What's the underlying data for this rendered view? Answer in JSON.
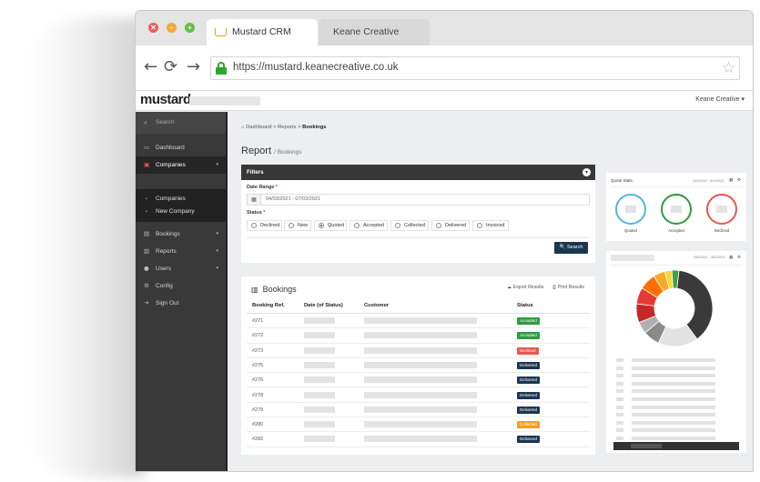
{
  "browser": {
    "tabs": [
      {
        "label": "Mustard CRM"
      },
      {
        "label": "Keane Creative"
      }
    ],
    "url": "https://mustard.keanecreative.co.uk",
    "nav_icons": {
      "back": "←",
      "reload": "⟳",
      "forward": "→",
      "star": "☆"
    },
    "window_buttons": {
      "close": "✕",
      "minimize": "–",
      "maximize": "+"
    }
  },
  "app": {
    "logo": "mustard",
    "user_menu": "Keane Creative ▾"
  },
  "sidebar": {
    "search_placeholder": "Search",
    "items": [
      {
        "label": "Dashboard",
        "icon": "monitor-icon",
        "glyph": "▭"
      },
      {
        "label": "Companies",
        "icon": "id-card-icon",
        "glyph": "▣",
        "caret": "▾"
      },
      {
        "label": "Bookings",
        "icon": "book-icon",
        "glyph": "▤",
        "caret": "▾"
      },
      {
        "label": "Reports",
        "icon": "bar-chart-icon",
        "glyph": "▥",
        "caret": "▾"
      },
      {
        "label": "Users",
        "icon": "users-icon",
        "glyph": "●",
        "caret": "▾"
      },
      {
        "label": "Config",
        "icon": "cogs-icon",
        "glyph": "⚙"
      },
      {
        "label": "Sign Out",
        "icon": "sign-out-icon",
        "glyph": "⇥"
      }
    ],
    "subitems": [
      {
        "label": "Companies"
      },
      {
        "label": "New Company"
      }
    ]
  },
  "breadcrumb": {
    "home": "⌂ Dashboard",
    "sep1": ">",
    "reports": "Reports",
    "sep2": ">",
    "current": "Bookings"
  },
  "page": {
    "title": "Report",
    "subtitle": "/ Bookings"
  },
  "filters": {
    "header": "Filters",
    "toggle": "▾",
    "date_label": "Date Range",
    "date_value": "04/03/2021 - 07/03/2021",
    "status_label": "Status",
    "required_mark": "*",
    "statuses": [
      {
        "label": "Declined",
        "selected": false
      },
      {
        "label": "New",
        "selected": false
      },
      {
        "label": "Quoted",
        "selected": true
      },
      {
        "label": "Accepted",
        "selected": false
      },
      {
        "label": "Collected",
        "selected": false
      },
      {
        "label": "Delivered",
        "selected": false
      },
      {
        "label": "Invoiced",
        "selected": false
      }
    ],
    "search_button": "🔍 Search"
  },
  "bookings": {
    "title": "Bookings",
    "export_label": "☁ Export Results",
    "print_label": "⎙ Print Results",
    "columns": [
      "Booking Ref.",
      "Date (of Status)",
      "Customer",
      "Status"
    ],
    "rows": [
      {
        "ref": "#271",
        "status": "Accepted",
        "color": "#2e9b3c"
      },
      {
        "ref": "#272",
        "status": "Accepted",
        "color": "#2e9b3c"
      },
      {
        "ref": "#273",
        "status": "Declined",
        "color": "#e8574c"
      },
      {
        "ref": "#275",
        "status": "Delivered",
        "color": "#1c3550"
      },
      {
        "ref": "#276",
        "status": "Delivered",
        "color": "#1c3550"
      },
      {
        "ref": "#278",
        "status": "Delivered",
        "color": "#1c3550"
      },
      {
        "ref": "#279",
        "status": "Delivered",
        "color": "#1c3550"
      },
      {
        "ref": "#280",
        "status": "Collected",
        "color": "#f0a020"
      },
      {
        "ref": "#282",
        "status": "Delivered",
        "color": "#1c3550"
      }
    ]
  },
  "quote_stats": {
    "title": "Quote Stats",
    "date": "03/03/2021 - 30/03/2021",
    "rings": [
      {
        "label": "Quoted",
        "color": "#4fb7e0"
      },
      {
        "label": "Accepted",
        "color": "#2e9b3c"
      },
      {
        "label": "Declined",
        "color": "#e8574c"
      }
    ]
  },
  "donut_card": {
    "date": "03/03/2021 - 05/03/2021",
    "segments": [
      {
        "color": "#3a3a3a",
        "share": 0.38
      },
      {
        "color": "#e2e2e2",
        "share": 0.17
      },
      {
        "color": "#8a8a8a",
        "share": 0.07
      },
      {
        "color": "#b0b0b0",
        "share": 0.05
      },
      {
        "color": "#c62828",
        "share": 0.08
      },
      {
        "color": "#e53935",
        "share": 0.07
      },
      {
        "color": "#ff6f00",
        "share": 0.07
      },
      {
        "color": "#f9a825",
        "share": 0.05
      },
      {
        "color": "#fdd835",
        "share": 0.03
      },
      {
        "color": "#43a047",
        "share": 0.03
      }
    ],
    "legend_rows": 11
  },
  "colors": {
    "sidebar_bg": "#393939",
    "dark_header": "#373737",
    "primary": "#1c3550"
  }
}
